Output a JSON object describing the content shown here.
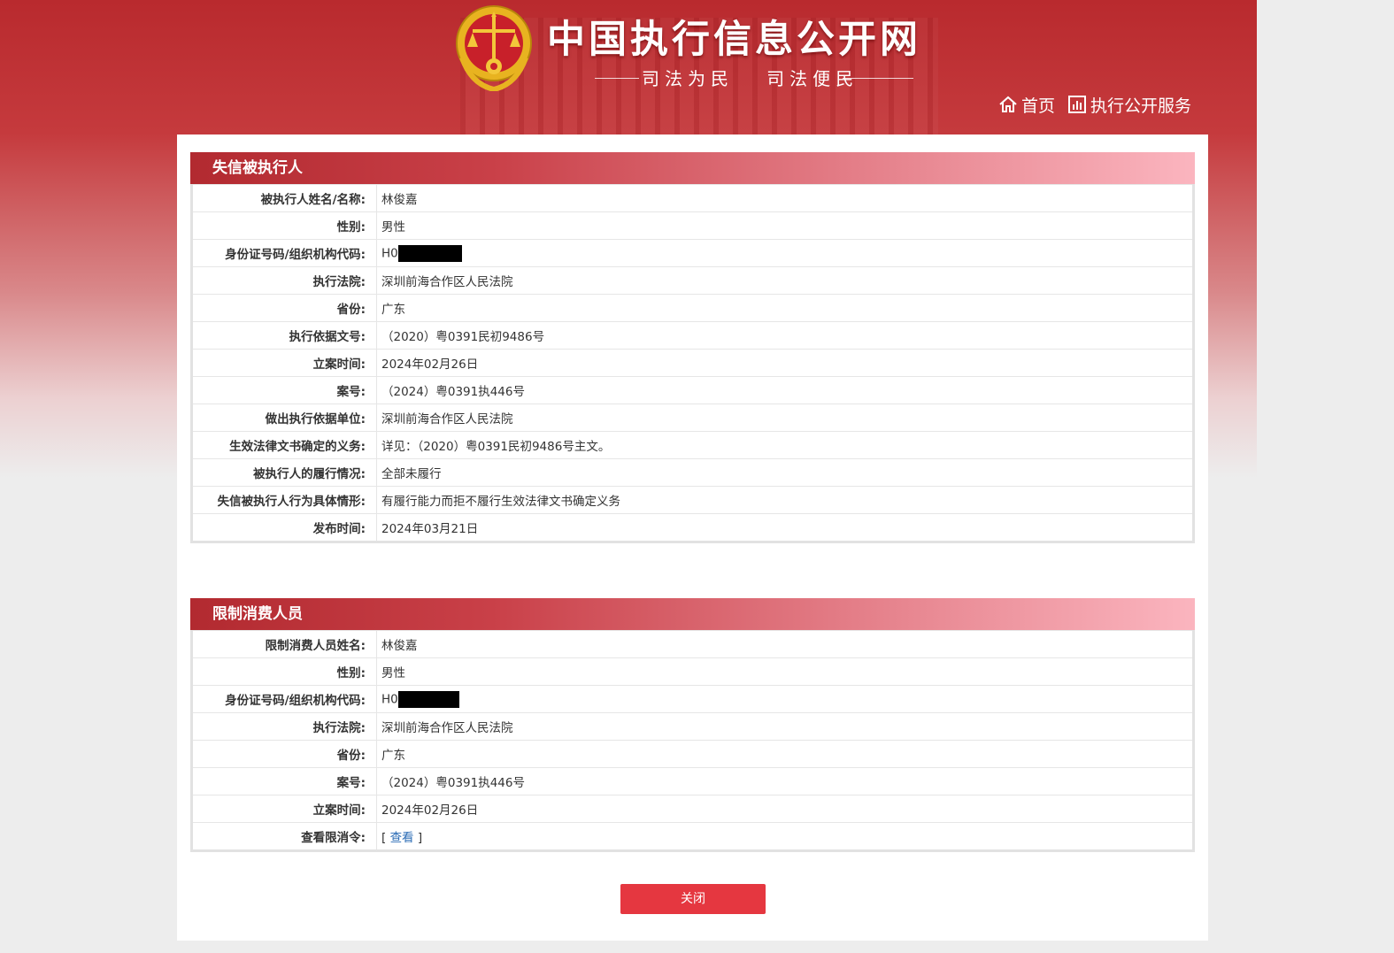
{
  "header": {
    "site_title": "中国执行信息公开网",
    "slogan": "司法为民   司法便民",
    "nav": [
      {
        "label": "首页",
        "icon": "home-icon"
      },
      {
        "label": "执行公开服务",
        "icon": "chart-icon"
      }
    ]
  },
  "dishonest": {
    "title": "失信被执行人",
    "rows": [
      {
        "key": "被执行人姓名/名称:",
        "value": "林俊嘉"
      },
      {
        "key": "性别:",
        "value": "男性"
      },
      {
        "key": "身份证号码/组织机构代码:",
        "value": "H0"
      },
      {
        "key": "执行法院:",
        "value": "深圳前海合作区人民法院"
      },
      {
        "key": "省份:",
        "value": "广东"
      },
      {
        "key": "执行依据文号:",
        "value": "（2020）粤0391民初9486号"
      },
      {
        "key": "立案时间:",
        "value": "2024年02月26日"
      },
      {
        "key": "案号:",
        "value": "（2024）粤0391执446号"
      },
      {
        "key": "做出执行依据单位:",
        "value": "深圳前海合作区人民法院"
      },
      {
        "key": "生效法律文书确定的义务:",
        "value": "详见：（2020）粤0391民初9486号主文。"
      },
      {
        "key": "被执行人的履行情况:",
        "value": "全部未履行"
      },
      {
        "key": "失信被执行人行为具体情形:",
        "value": "有履行能力而拒不履行生效法律文书确定义务"
      },
      {
        "key": "发布时间:",
        "value": "2024年03月21日"
      }
    ]
  },
  "restricted": {
    "title": "限制消费人员",
    "rows": [
      {
        "key": "限制消费人员姓名:",
        "value": "林俊嘉"
      },
      {
        "key": "性别:",
        "value": "男性"
      },
      {
        "key": "身份证号码/组织机构代码:",
        "value": "H0"
      },
      {
        "key": "执行法院:",
        "value": "深圳前海合作区人民法院"
      },
      {
        "key": "省份:",
        "value": "广东"
      },
      {
        "key": "案号:",
        "value": "（2024）粤0391执446号"
      },
      {
        "key": "立案时间:",
        "value": "2024年02月26日"
      },
      {
        "key": "查看限消令:",
        "value": ""
      }
    ],
    "view_order_open": "[ ",
    "view_order_link": "查看",
    "view_order_close": " ]"
  },
  "close_label": "关闭",
  "colors": {
    "brand_red": "#b92a2e",
    "button_red": "#e53740",
    "link_blue": "#2a6bb5"
  }
}
